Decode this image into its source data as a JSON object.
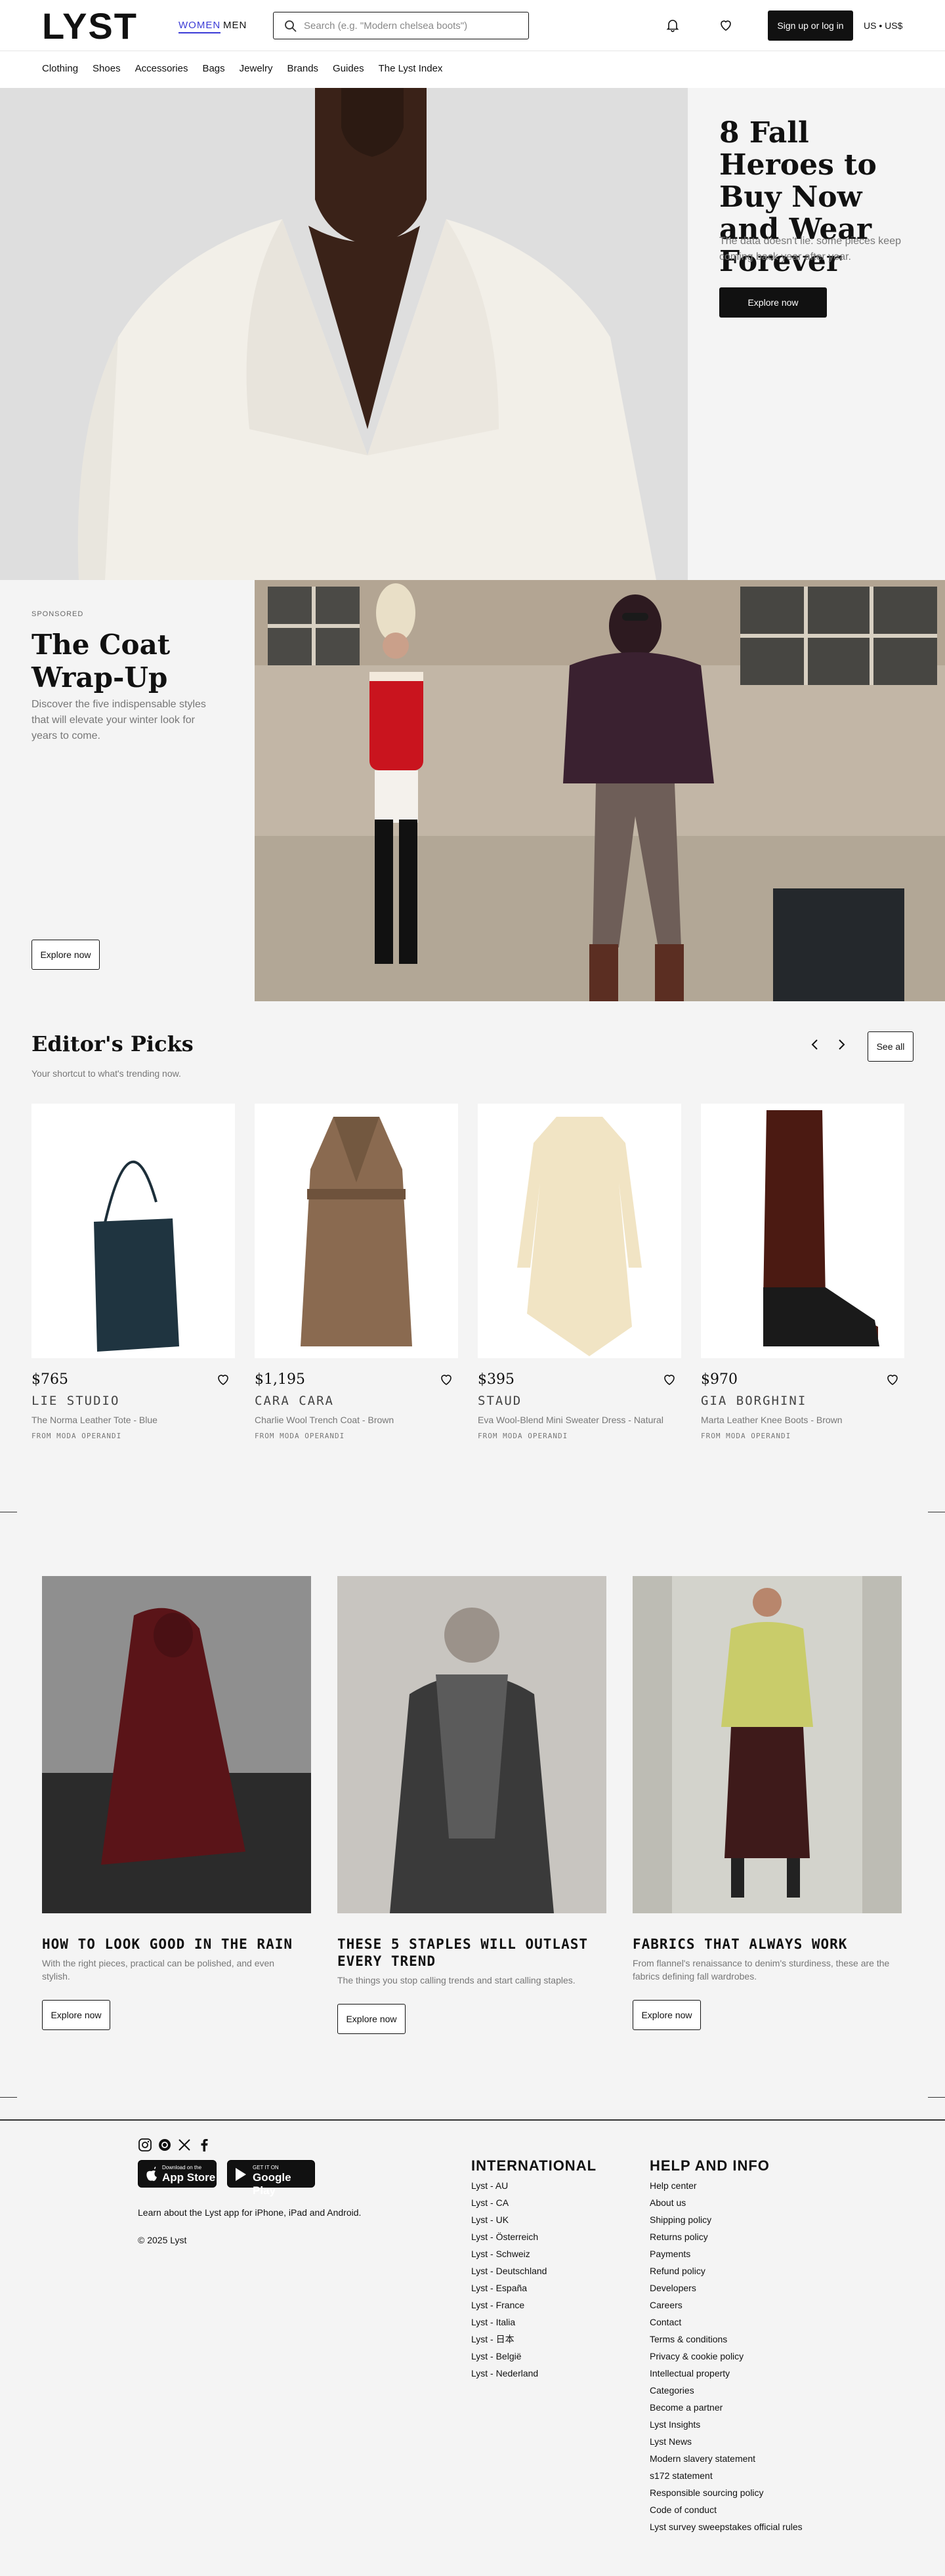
{
  "header": {
    "logo": "LYST",
    "women": "WOMEN",
    "men": "MEN",
    "search_placeholder": "Search (e.g. \"Modern chelsea boots\")",
    "signup": "Sign up or log in",
    "locale": "US • US$",
    "icons": [
      "search-icon",
      "bell-icon",
      "heart-icon"
    ]
  },
  "nav": [
    "Clothing",
    "Shoes",
    "Accessories",
    "Bags",
    "Jewelry",
    "Brands",
    "Guides",
    "The Lyst Index"
  ],
  "hero1": {
    "title": "8 Fall Heroes to Buy Now and Wear Forever",
    "subtitle": "The data doesn't lie: some pieces keep coming back year after year.",
    "cta": "Explore now"
  },
  "hero2": {
    "sponsored": "SPONSORED",
    "title": "The Coat Wrap-Up",
    "subtitle": "Discover the five indispensable styles that will elevate your winter look for years to come.",
    "cta": "Explore now"
  },
  "picks": {
    "title": "Editor's Picks",
    "subtitle": "Your shortcut to what's trending now.",
    "see_all": "See all",
    "items": [
      {
        "price": "$765",
        "brand": "LIE STUDIO",
        "name": "The Norma Leather Tote - Blue",
        "retailer": "FROM MODA OPERANDI"
      },
      {
        "price": "$1,195",
        "brand": "CARA CARA",
        "name": "Charlie Wool Trench Coat - Brown",
        "retailer": "FROM MODA OPERANDI"
      },
      {
        "price": "$395",
        "brand": "STAUD",
        "name": "Eva Wool-Blend Mini Sweater Dress - Natural",
        "retailer": "FROM MODA OPERANDI"
      },
      {
        "price": "$970",
        "brand": "GIA BORGHINI",
        "name": "Marta Leather Knee Boots - Brown",
        "retailer": "FROM MODA OPERANDI"
      }
    ]
  },
  "articles": [
    {
      "title": "HOW TO LOOK GOOD IN THE RAIN",
      "desc": "With the right pieces, practical can be polished, and even stylish.",
      "cta": "Explore now"
    },
    {
      "title": "THESE 5 STAPLES WILL OUTLAST EVERY TREND",
      "desc": "The things you stop calling trends and start calling staples.",
      "cta": "Explore now"
    },
    {
      "title": "FABRICS THAT ALWAYS WORK",
      "desc": "From flannel's renaissance to denim's sturdiness, these are the fabrics defining fall wardrobes.",
      "cta": "Explore now"
    }
  ],
  "footer": {
    "social_icons": [
      "instagram-icon",
      "threads-icon",
      "x-icon",
      "facebook-icon"
    ],
    "appstore_small": "Download on the",
    "appstore_big": "App Store",
    "googleplay_small": "GET IT ON",
    "googleplay_big": "Google Play",
    "app_note": "Learn about the Lyst app for iPhone, iPad and Android.",
    "copyright": "© 2025 Lyst",
    "international_title": "INTERNATIONAL",
    "international": [
      "Lyst - AU",
      "Lyst - CA",
      "Lyst - UK",
      "Lyst - Österreich",
      "Lyst - Schweiz",
      "Lyst - Deutschland",
      "Lyst - España",
      "Lyst - France",
      "Lyst - Italia",
      "Lyst - 日本",
      "Lyst - België",
      "Lyst - Nederland"
    ],
    "help_title": "HELP AND INFO",
    "help": [
      "Help center",
      "About us",
      "Shipping policy",
      "Returns policy",
      "Payments",
      "Refund policy",
      "Developers",
      "Careers",
      "Contact",
      "Terms & conditions",
      "Privacy & cookie policy",
      "Intellectual property",
      "Categories",
      "Become a partner",
      "Lyst Insights",
      "Lyst News",
      "Modern slavery statement",
      "s172 statement",
      "Responsible sourcing policy",
      "Code of conduct",
      "Lyst survey sweepstakes official rules"
    ]
  }
}
